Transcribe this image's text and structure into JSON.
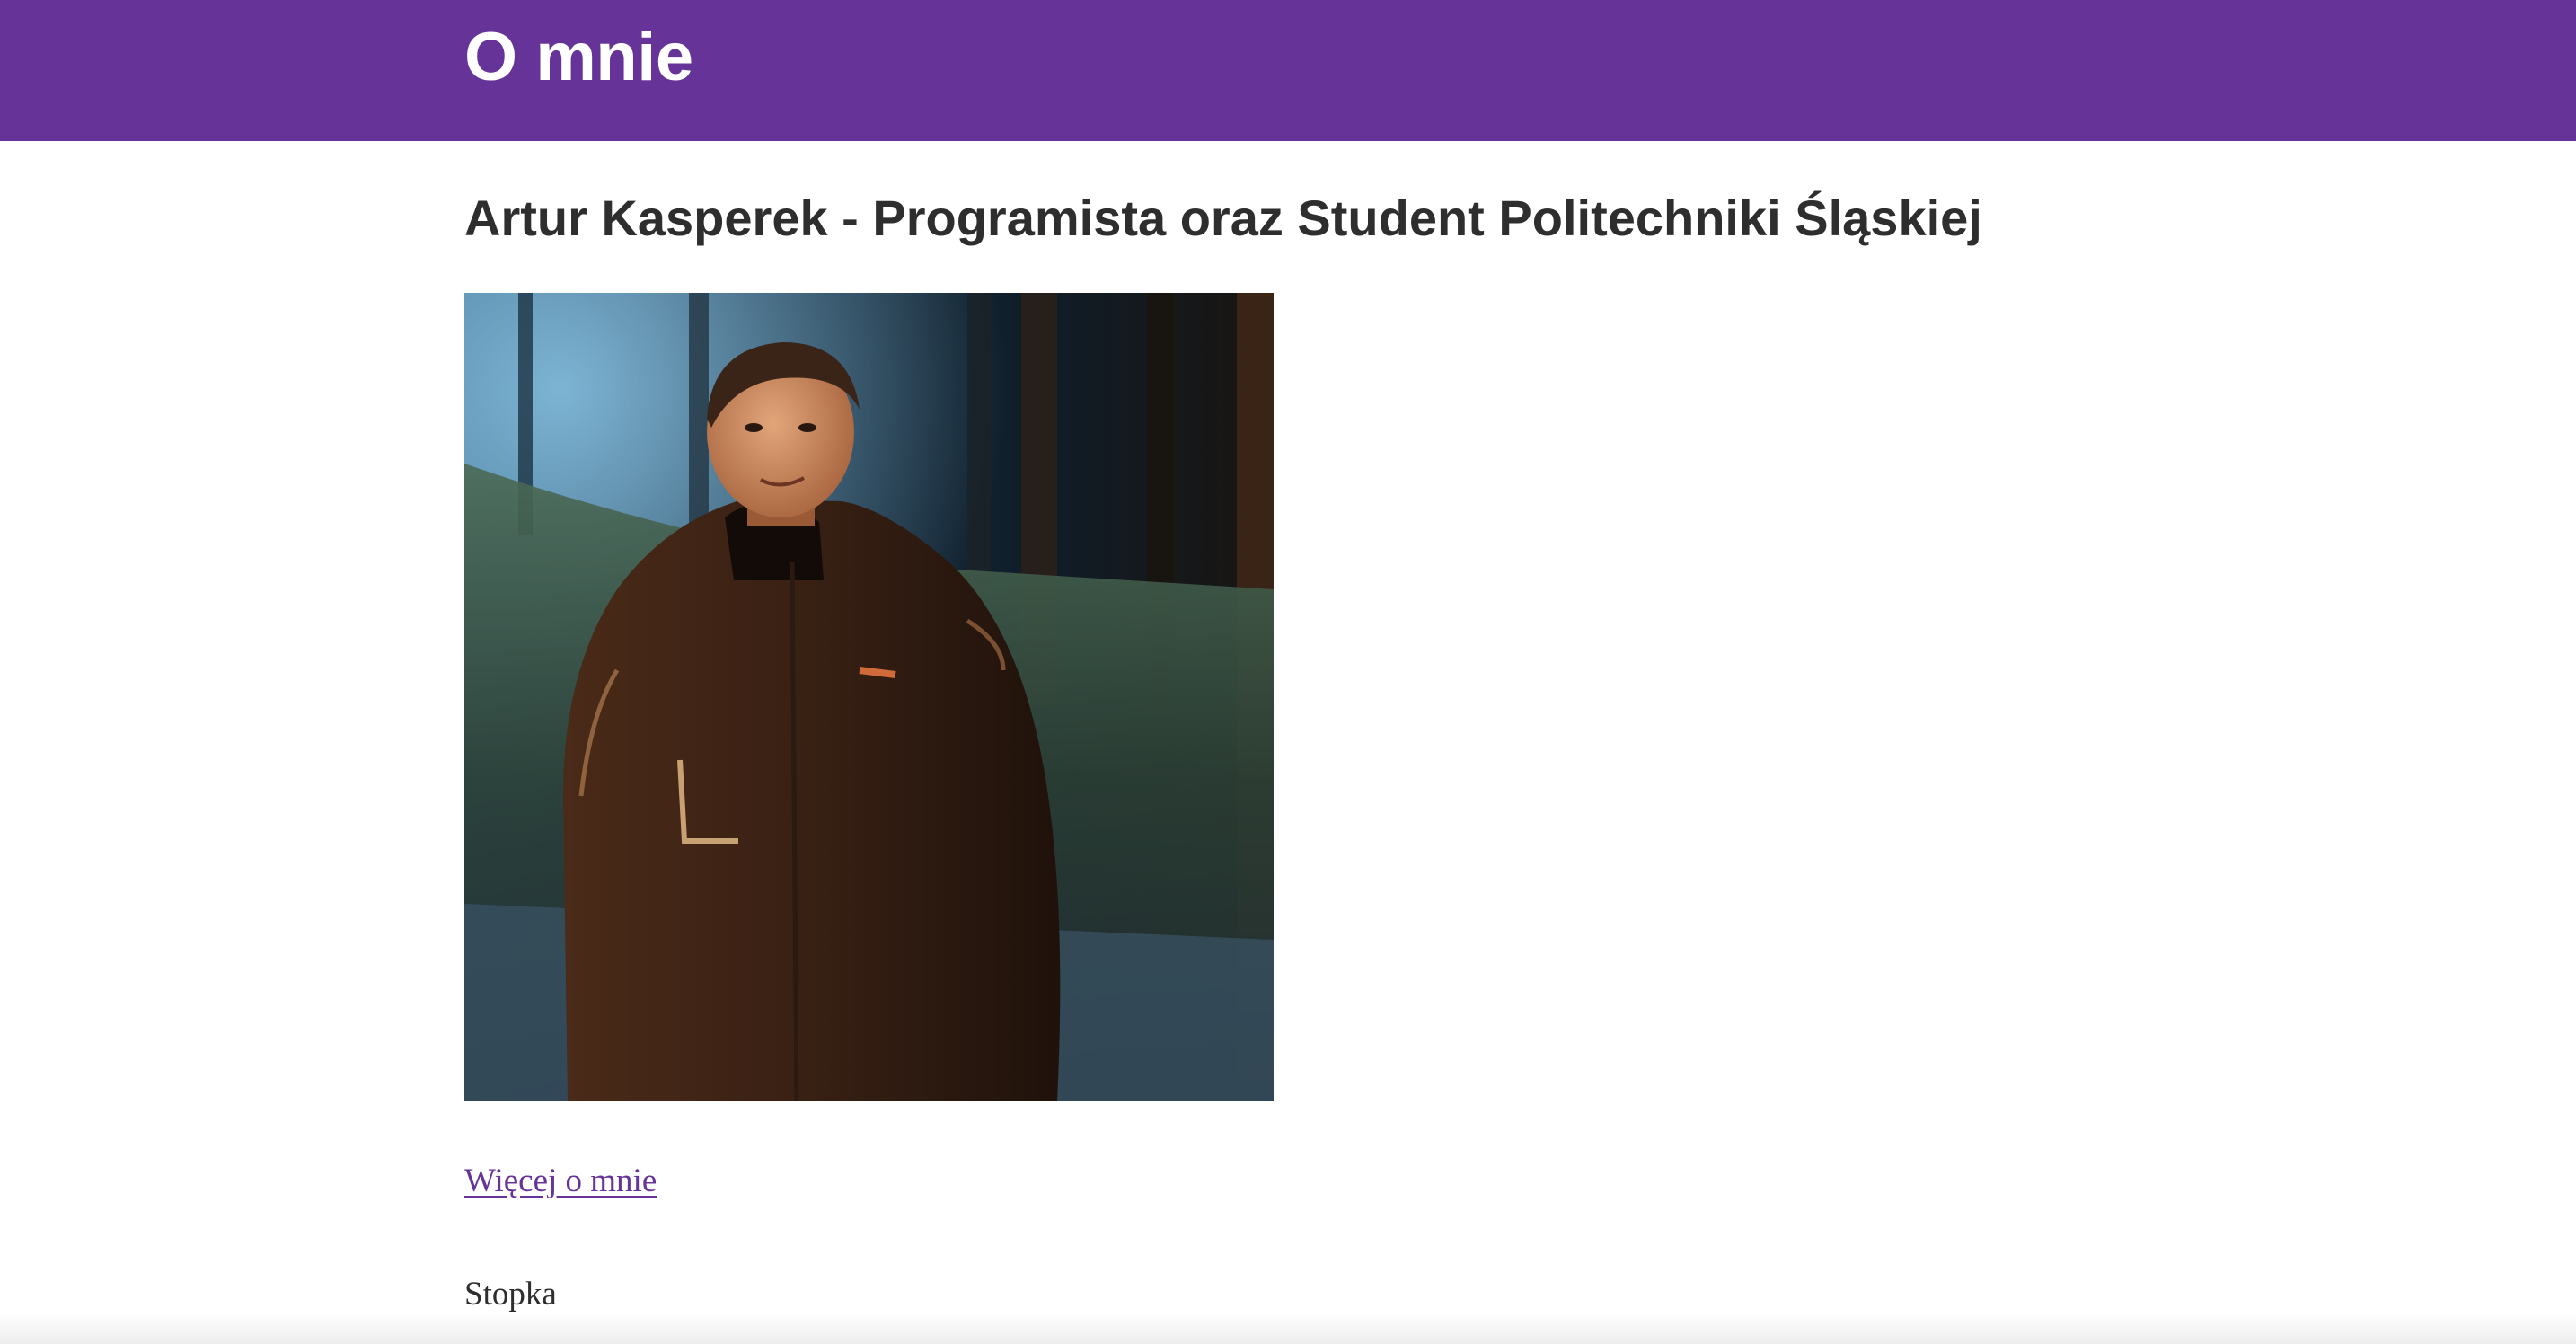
{
  "header": {
    "title": "O mnie",
    "background_color": "#663399"
  },
  "main": {
    "heading": "Artur Kasperek - Programista oraz Student Politechniki Śląskiej",
    "photo": {
      "icon": "portrait-photo"
    },
    "more_link": {
      "label": "Więcej o mnie",
      "color": "#663399"
    }
  },
  "footer": {
    "text": "Stopka"
  }
}
